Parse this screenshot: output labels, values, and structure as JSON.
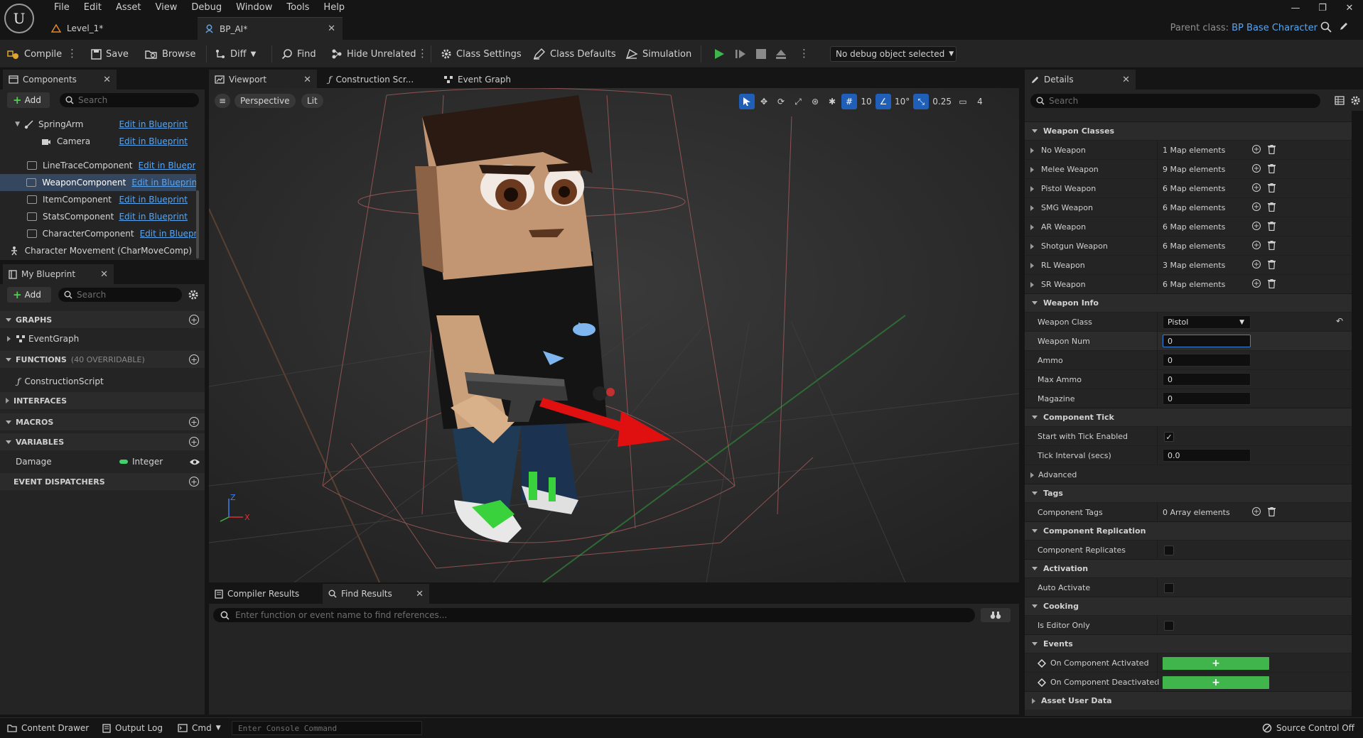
{
  "menu": [
    "File",
    "Edit",
    "Asset",
    "View",
    "Debug",
    "Window",
    "Tools",
    "Help"
  ],
  "logo_text": "U",
  "doc_tabs": {
    "level": "Level_1*",
    "blueprint": "BP_AI*"
  },
  "parent_class": {
    "label": "Parent class:",
    "value": "BP Base Character"
  },
  "toolbar": {
    "compile": "Compile",
    "save": "Save",
    "browse": "Browse",
    "diff": "Diff",
    "find": "Find",
    "hide_unrelated": "Hide Unrelated",
    "class_settings": "Class Settings",
    "class_defaults": "Class Defaults",
    "simulation": "Simulation",
    "debug_object": "No debug object selected"
  },
  "components_panel": {
    "title": "Components",
    "add": "Add",
    "search_placeholder": "Search",
    "items": [
      {
        "name": "SpringArm",
        "link": "Edit in Blueprint"
      },
      {
        "name": "Camera",
        "link": "Edit in Blueprint"
      },
      {
        "name": "LineTraceComponent",
        "link": "Edit in Blueprint"
      },
      {
        "name": "WeaponComponent",
        "link": "Edit in Blueprint"
      },
      {
        "name": "ItemComponent",
        "link": "Edit in Blueprint"
      },
      {
        "name": "StatsComponent",
        "link": "Edit in Blueprint"
      },
      {
        "name": "CharacterComponent",
        "link": "Edit in Blueprint"
      },
      {
        "name": "Character Movement (CharMoveComp)",
        "link": ""
      }
    ]
  },
  "my_blueprint": {
    "title": "My Blueprint",
    "add": "Add",
    "search_placeholder": "Search",
    "graphs": "GRAPHS",
    "event_graph": "EventGraph",
    "functions": "FUNCTIONS",
    "functions_sub": "(40 OVERRIDABLE)",
    "construction_script": "ConstructionScript",
    "interfaces": "INTERFACES",
    "macros": "MACROS",
    "variables": "VARIABLES",
    "variable": {
      "name": "Damage",
      "type": "Integer",
      "type_color": "#3fd16a"
    },
    "event_dispatchers": "EVENT DISPATCHERS"
  },
  "center_tabs": {
    "viewport": "Viewport",
    "construction": "Construction Scr...",
    "event_graph": "Event Graph"
  },
  "viewport": {
    "perspective": "Perspective",
    "lit": "Lit",
    "grid_snap": "10",
    "rot_snap": "10°",
    "scale_snap": "0.25",
    "camera_speed": "4",
    "axis_z": "Z",
    "axis_x": "X"
  },
  "bottom_panel": {
    "compiler_results": "Compiler Results",
    "find_results": "Find Results",
    "find_placeholder": "Enter function or event name to find references..."
  },
  "details": {
    "title": "Details",
    "search_placeholder": "Search",
    "weapon_classes": {
      "header": "Weapon Classes",
      "rows": [
        {
          "label": "No Weapon",
          "value": "1 Map elements"
        },
        {
          "label": "Melee Weapon",
          "value": "9 Map elements"
        },
        {
          "label": "Pistol Weapon",
          "value": "6 Map elements"
        },
        {
          "label": "SMG Weapon",
          "value": "6 Map elements"
        },
        {
          "label": "AR Weapon",
          "value": "6 Map elements"
        },
        {
          "label": "Shotgun Weapon",
          "value": "6 Map elements"
        },
        {
          "label": "RL Weapon",
          "value": "3 Map elements"
        },
        {
          "label": "SR Weapon",
          "value": "6 Map elements"
        }
      ]
    },
    "weapon_info": {
      "header": "Weapon Info",
      "weapon_class_label": "Weapon Class",
      "weapon_class_value": "Pistol",
      "weapon_num_label": "Weapon Num",
      "weapon_num_value": "0",
      "ammo_label": "Ammo",
      "ammo_value": "0",
      "max_ammo_label": "Max Ammo",
      "max_ammo_value": "0",
      "magazine_label": "Magazine",
      "magazine_value": "0"
    },
    "component_tick": {
      "header": "Component Tick",
      "start_label": "Start with Tick Enabled",
      "interval_label": "Tick Interval (secs)",
      "interval_value": "0.0",
      "advanced": "Advanced"
    },
    "tags": {
      "header": "Tags",
      "label": "Component Tags",
      "value": "0 Array elements"
    },
    "replication": {
      "header": "Component Replication",
      "label": "Component Replicates"
    },
    "activation": {
      "header": "Activation",
      "label": "Auto Activate"
    },
    "cooking": {
      "header": "Cooking",
      "label": "Is Editor Only"
    },
    "events": {
      "header": "Events",
      "activated": "On Component Activated",
      "deactivated": "On Component Deactivated",
      "button": "+"
    },
    "asset_user_data": "Asset User Data"
  },
  "statusbar": {
    "content_drawer": "Content Drawer",
    "output_log": "Output Log",
    "cmd": "Cmd",
    "console_placeholder": "Enter Console Command",
    "source_control": "Source Control Off"
  },
  "colors": {
    "accent": "#1f5fb8",
    "link": "#5aa5f0",
    "play": "#3fb54b",
    "selection": "#35475f",
    "arrow": "#e01010"
  }
}
